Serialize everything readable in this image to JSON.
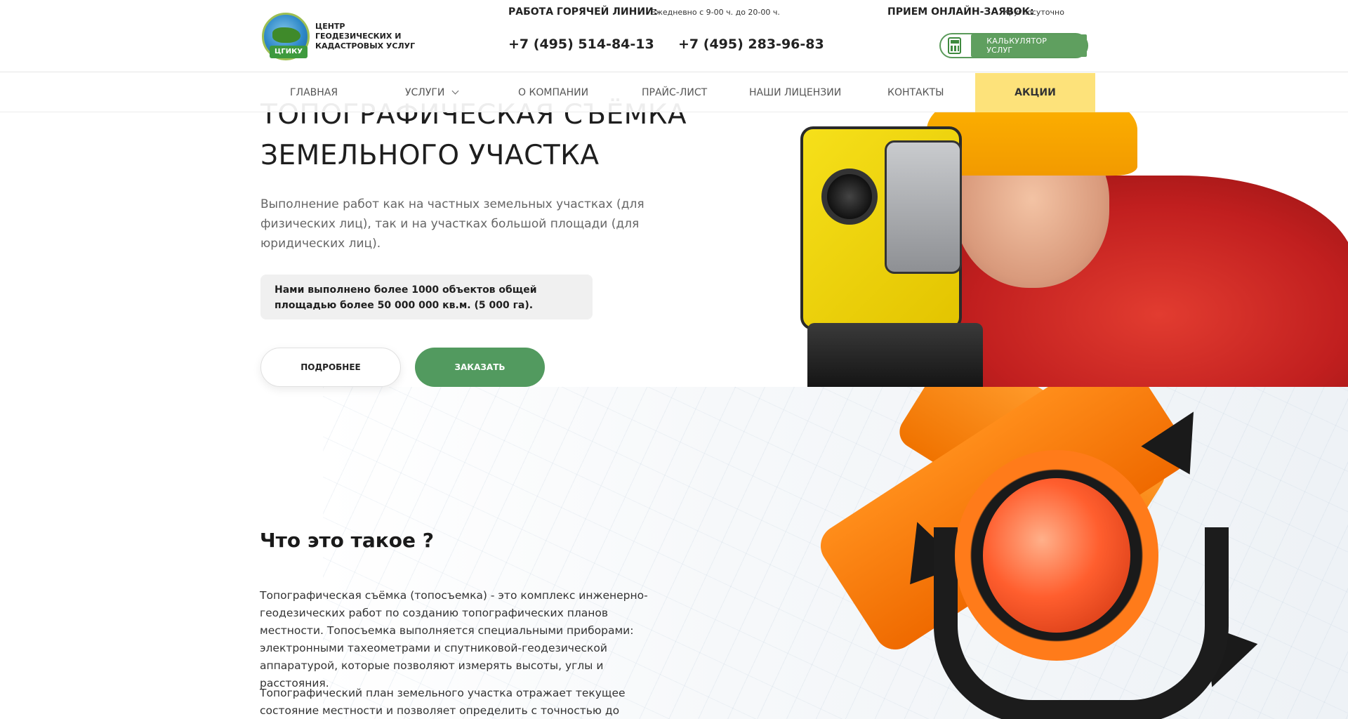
{
  "header": {
    "logo_text": "ЦЕНТР ГЕОДЕЗИЧЕСКИХ И КАДАСТРОВЫХ УСЛУГ",
    "logo_badge": "ЦГИКУ",
    "hotline_label": "РАБОТА ГОРЯЧЕЙ ЛИНИИ:",
    "hotline_hours": "Ежедневно с 9-00 ч. до 20-00 ч.",
    "phone_1": "+7 (495) 514-84-13",
    "phone_2": "+7 (495) 283-96-83",
    "online_label": "ПРИЕМ ОНЛАЙН-ЗАЯВОК:",
    "online_hours": "Круглосуточно",
    "calculator_label": "КАЛЬКУЛЯТОР УСЛУГ"
  },
  "nav": {
    "items": [
      {
        "label": "ГЛАВНАЯ"
      },
      {
        "label": "УСЛУГИ"
      },
      {
        "label": "О КОМПАНИИ"
      },
      {
        "label": "ПРАЙС-ЛИСТ"
      },
      {
        "label": "НАШИ ЛИЦЕНЗИИ"
      },
      {
        "label": "КОНТАКТЫ"
      },
      {
        "label": "АКЦИИ"
      }
    ]
  },
  "hero": {
    "title": "ТОПОГРАФИЧЕСКАЯ СЪЁМКА ЗЕМЕЛЬНОГО УЧАСТКА",
    "subtitle": "Выполнение работ как на частных земельных участках (для физических лиц), так и на участках большой площади (для юридических лиц).",
    "stat": "Нами выполнено более 1000 объектов общей площадью более 50 000 000 кв.м. (5 000 га).",
    "more_button": "ПОДРОБНЕЕ",
    "order_button": "ЗАКАЗАТЬ"
  },
  "about": {
    "title": "Что это такое ?",
    "paragraph_1": "Топографическая съёмка (топосъемка) - это комплекс инженерно-геодезических работ по созданию топографических планов местности. Топосъемка выполняется специальными приборами: электронными тахеометрами и спутниковой-геодезической аппаратурой, которые позволяют измерять высоты, углы и расстояния.",
    "paragraph_2": "Топографический план земельного участка отражает текущее состояние местности и позволяет определить с точностью до сантиметров такие"
  },
  "colors": {
    "accent_green": "#529a5f",
    "promo_yellow": "#fde27a",
    "text_dark": "#1e1e1e"
  }
}
